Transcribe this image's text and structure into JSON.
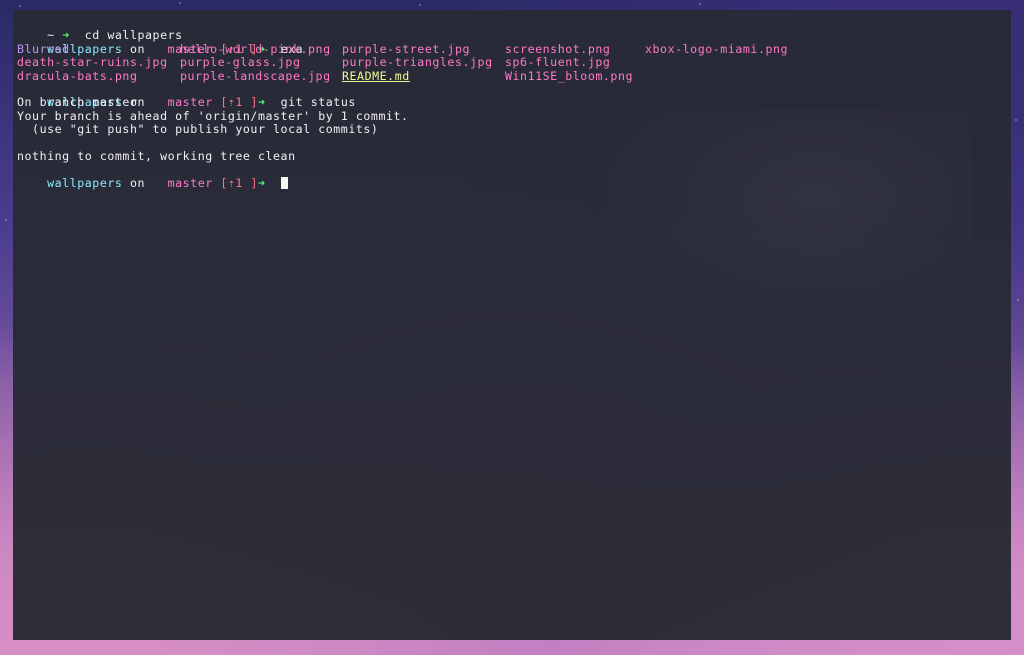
{
  "colors": {
    "background": "#282a36",
    "cwd": "#8be9fd",
    "branch": "#ff79c6",
    "arrow": "#50fa7b",
    "ahead": "#ff6e8a",
    "file": "#ff79c6",
    "directory": "#bd93f9",
    "readme": "#f1fa8c"
  },
  "prompt": {
    "home": "~",
    "arrow": "➜",
    "cwd": "wallpapers",
    "on": "on",
    "branch_icon": "",
    "branch": "master",
    "ahead": "[⇡1 ]"
  },
  "commands": {
    "cd": "cd wallpapers",
    "exa": "exa",
    "git_status": "git status"
  },
  "exa_rows": [
    [
      "Blurred",
      "hello-world-pink.png",
      "purple-street.jpg",
      "screenshot.png",
      "xbox-logo-miami.png"
    ],
    [
      "death-star-ruins.jpg",
      "purple-glass.jpg",
      "purple-triangles.jpg",
      "sp6-fluent.jpg",
      ""
    ],
    [
      "dracula-bats.png",
      "purple-landscape.jpg",
      "README.md",
      "Win11SE_bloom.png",
      ""
    ]
  ],
  "git_status_output": [
    "On branch master",
    "Your branch is ahead of 'origin/master' by 1 commit.",
    "  (use \"git push\" to publish your local commits)",
    "",
    "nothing to commit, working tree clean"
  ]
}
